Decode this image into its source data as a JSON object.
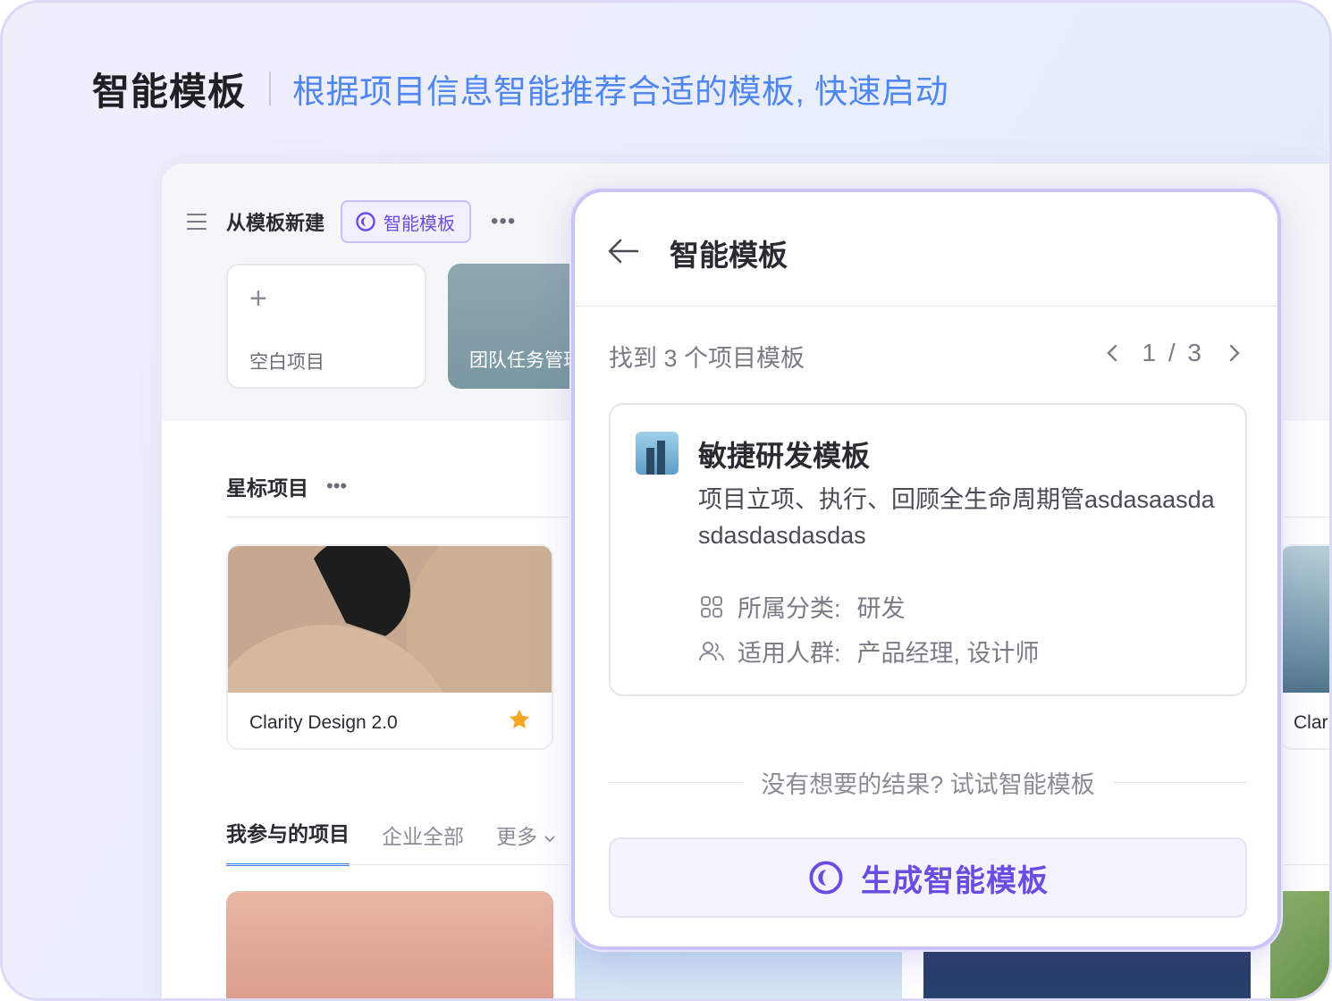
{
  "hero": {
    "title": "智能模板",
    "subtitle": "根据项目信息智能推荐合适的模板, 快速启动"
  },
  "app": {
    "title": "从模板新建",
    "ai_chip_label": "智能模板",
    "templates": [
      {
        "label": "空白项目"
      },
      {
        "label": "团队任务管理"
      }
    ],
    "starred_section_title": "星标项目",
    "starred_projects": [
      {
        "name": "Clarity Design 2.0"
      },
      {
        "name": "Clar"
      }
    ],
    "tabs": [
      {
        "label": "我参与的项目"
      },
      {
        "label": "企业全部"
      },
      {
        "label": "更多"
      }
    ]
  },
  "popup": {
    "title": "智能模板",
    "found_text": "找到 3 个项目模板",
    "pager_text": "1 / 3",
    "result": {
      "name": "敏捷研发模板",
      "description": "项目立项、执行、回顾全生命周期管asdasaasdasdasdasdasdas",
      "category_key": "所属分类:",
      "category_value": "研发",
      "audience_key": "适用人群:",
      "audience_value": "产品经理, 设计师"
    },
    "divider_text": "没有想要的结果? 试试智能模板",
    "generate_button": "生成智能模板"
  },
  "colors": {
    "accent_purple": "#6a4de0",
    "hero_subtitle_blue": "#4f86f0",
    "tab_active_underline": "#3b82f0",
    "star_orange": "#f5a623"
  },
  "icons": [
    "menu-icon",
    "ai-spark-icon",
    "more-icon",
    "plus-icon",
    "star-icon",
    "back-arrow-icon",
    "chevron-left-icon",
    "chevron-right-icon",
    "category-grid-icon",
    "users-icon",
    "chevron-down-icon"
  ]
}
